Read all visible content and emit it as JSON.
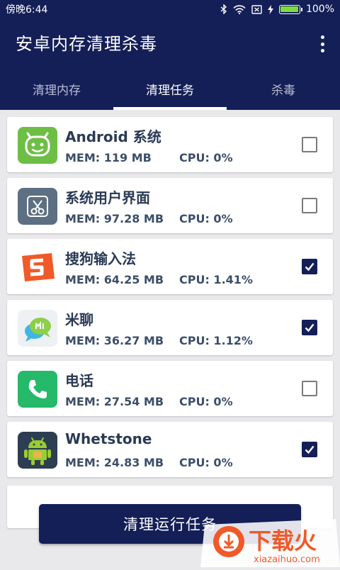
{
  "status_bar": {
    "time": "傍晚6:44",
    "battery_percent": "100%",
    "battery_level": 1.0,
    "icons": [
      "bluetooth-icon",
      "wifi-icon",
      "sim-icon",
      "charging-icon",
      "battery-icon"
    ]
  },
  "app_bar": {
    "title": "安卓内存清理杀毒",
    "menu_icon": "more-vert-icon"
  },
  "tabs": [
    {
      "label": "清理内存",
      "active": false
    },
    {
      "label": "清理任务",
      "active": true
    },
    {
      "label": "杀毒",
      "active": false
    }
  ],
  "tasks": [
    {
      "name": "Android 系统",
      "mem": "MEM: 119 MB",
      "cpu": "CPU: 0%",
      "checked": false,
      "icon": "android-system-icon"
    },
    {
      "name": "系统用户界面",
      "mem": "MEM: 97.28 MB",
      "cpu": "CPU: 0%",
      "checked": false,
      "icon": "system-ui-icon"
    },
    {
      "name": "搜狗输入法",
      "mem": "MEM: 64.25 MB",
      "cpu": "CPU: 1.41%",
      "checked": true,
      "icon": "sogou-input-icon"
    },
    {
      "name": "米聊",
      "mem": "MEM: 36.27 MB",
      "cpu": "CPU: 1.12%",
      "checked": true,
      "icon": "mitalk-icon"
    },
    {
      "name": "电话",
      "mem": "MEM: 27.54 MB",
      "cpu": "CPU: 0%",
      "checked": false,
      "icon": "phone-icon"
    },
    {
      "name": "Whetstone",
      "mem": "MEM: 24.83 MB",
      "cpu": "CPU: 0%",
      "checked": true,
      "icon": "whetstone-icon"
    }
  ],
  "clean_button": {
    "label": "清理运行任务"
  },
  "watermark": {
    "brand": "下载火",
    "url": "xiazaihuo.com"
  },
  "colors": {
    "primary": "#141f57",
    "accent_green": "#7ddc3c",
    "watermark_orange": "#f05a28"
  }
}
